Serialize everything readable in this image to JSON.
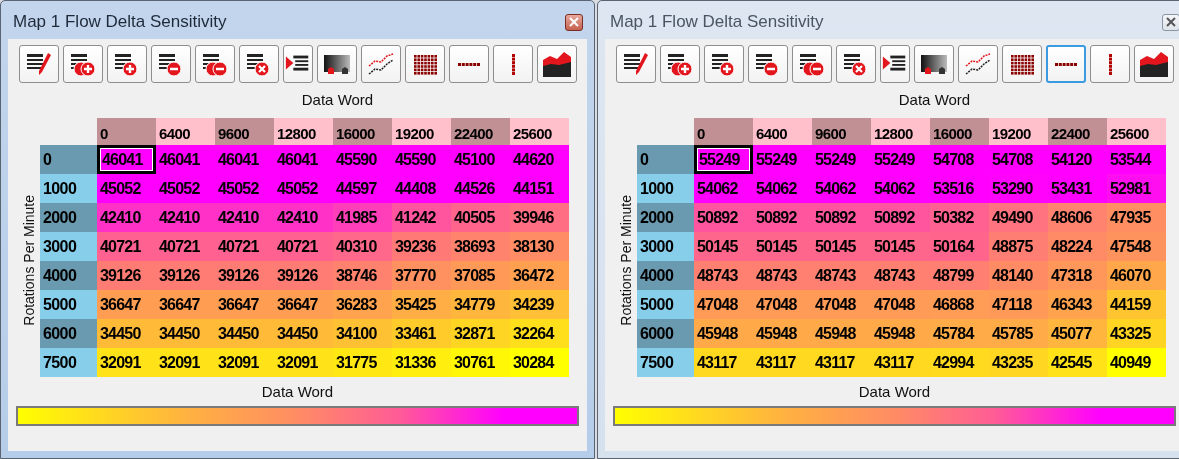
{
  "windows": [
    {
      "title": "Map 1 Flow Delta Sensitivity",
      "active": true,
      "toolbar": [
        {
          "kind": "edit",
          "selected": false
        },
        {
          "kind": "insert-columns",
          "selected": false
        },
        {
          "kind": "insert-row",
          "selected": false
        },
        {
          "kind": "delete-row",
          "selected": false
        },
        {
          "kind": "delete-columns",
          "selected": false
        },
        {
          "kind": "clear",
          "selected": false
        },
        {
          "kind": "export",
          "selected": false
        },
        {
          "kind": "gradient",
          "selected": false
        },
        {
          "kind": "line-chart",
          "selected": false
        },
        {
          "kind": "grid",
          "selected": false
        },
        {
          "kind": "row-line",
          "selected": false
        },
        {
          "kind": "column-line",
          "selected": false
        },
        {
          "kind": "area-chart",
          "selected": false
        }
      ],
      "top_axis_label": "Data Word",
      "side_axis_label": "Rotations Per Minute",
      "bottom_axis_label": "Data Word",
      "columns": [
        "0",
        "6400",
        "9600",
        "12800",
        "16000",
        "19200",
        "22400",
        "25600"
      ],
      "rows": [
        {
          "label": "0",
          "cells": [
            {
              "value": "46041",
              "selected": true
            },
            {
              "value": "46041",
              "selected": false
            },
            {
              "value": "46041",
              "selected": false
            },
            {
              "value": "46041",
              "selected": false
            },
            {
              "value": "45590",
              "selected": false
            },
            {
              "value": "45590",
              "selected": false
            },
            {
              "value": "45100",
              "selected": false
            },
            {
              "value": "44620",
              "selected": false
            }
          ]
        },
        {
          "label": "1000",
          "cells": [
            {
              "value": "45052",
              "selected": false
            },
            {
              "value": "45052",
              "selected": false
            },
            {
              "value": "45052",
              "selected": false
            },
            {
              "value": "45052",
              "selected": false
            },
            {
              "value": "44597",
              "selected": false
            },
            {
              "value": "44408",
              "selected": false
            },
            {
              "value": "44526",
              "selected": false
            },
            {
              "value": "44151",
              "selected": false
            }
          ]
        },
        {
          "label": "2000",
          "cells": [
            {
              "value": "42410",
              "selected": false
            },
            {
              "value": "42410",
              "selected": false
            },
            {
              "value": "42410",
              "selected": false
            },
            {
              "value": "42410",
              "selected": false
            },
            {
              "value": "41985",
              "selected": false
            },
            {
              "value": "41242",
              "selected": false
            },
            {
              "value": "40505",
              "selected": false
            },
            {
              "value": "39946",
              "selected": false
            }
          ]
        },
        {
          "label": "3000",
          "cells": [
            {
              "value": "40721",
              "selected": false
            },
            {
              "value": "40721",
              "selected": false
            },
            {
              "value": "40721",
              "selected": false
            },
            {
              "value": "40721",
              "selected": false
            },
            {
              "value": "40310",
              "selected": false
            },
            {
              "value": "39236",
              "selected": false
            },
            {
              "value": "38693",
              "selected": false
            },
            {
              "value": "38130",
              "selected": false
            }
          ]
        },
        {
          "label": "4000",
          "cells": [
            {
              "value": "39126",
              "selected": false
            },
            {
              "value": "39126",
              "selected": false
            },
            {
              "value": "39126",
              "selected": false
            },
            {
              "value": "39126",
              "selected": false
            },
            {
              "value": "38746",
              "selected": false
            },
            {
              "value": "37770",
              "selected": false
            },
            {
              "value": "37085",
              "selected": false
            },
            {
              "value": "36472",
              "selected": false
            }
          ]
        },
        {
          "label": "5000",
          "cells": [
            {
              "value": "36647",
              "selected": false
            },
            {
              "value": "36647",
              "selected": false
            },
            {
              "value": "36647",
              "selected": false
            },
            {
              "value": "36647",
              "selected": false
            },
            {
              "value": "36283",
              "selected": false
            },
            {
              "value": "35425",
              "selected": false
            },
            {
              "value": "34779",
              "selected": false
            },
            {
              "value": "34239",
              "selected": false
            }
          ]
        },
        {
          "label": "6000",
          "cells": [
            {
              "value": "34450",
              "selected": false
            },
            {
              "value": "34450",
              "selected": false
            },
            {
              "value": "34450",
              "selected": false
            },
            {
              "value": "34450",
              "selected": false
            },
            {
              "value": "34100",
              "selected": false
            },
            {
              "value": "33461",
              "selected": false
            },
            {
              "value": "32871",
              "selected": false
            },
            {
              "value": "32264",
              "selected": false
            }
          ]
        },
        {
          "label": "7500",
          "cells": [
            {
              "value": "32091",
              "selected": false
            },
            {
              "value": "32091",
              "selected": false
            },
            {
              "value": "32091",
              "selected": false
            },
            {
              "value": "32091",
              "selected": false
            },
            {
              "value": "31775",
              "selected": false
            },
            {
              "value": "31336",
              "selected": false
            },
            {
              "value": "30761",
              "selected": false
            },
            {
              "value": "30284",
              "selected": false
            }
          ]
        }
      ]
    },
    {
      "title": "Map 1 Flow Delta Sensitivity",
      "active": false,
      "toolbar": [
        {
          "kind": "edit",
          "selected": false
        },
        {
          "kind": "insert-columns",
          "selected": false
        },
        {
          "kind": "insert-row",
          "selected": false
        },
        {
          "kind": "delete-row",
          "selected": false
        },
        {
          "kind": "delete-columns",
          "selected": false
        },
        {
          "kind": "clear",
          "selected": false
        },
        {
          "kind": "export",
          "selected": false
        },
        {
          "kind": "gradient",
          "selected": false
        },
        {
          "kind": "line-chart",
          "selected": false
        },
        {
          "kind": "grid",
          "selected": false
        },
        {
          "kind": "row-line",
          "selected": true
        },
        {
          "kind": "column-line",
          "selected": false
        },
        {
          "kind": "area-chart",
          "selected": false
        }
      ],
      "top_axis_label": "Data Word",
      "side_axis_label": "Rotations Per Minute",
      "bottom_axis_label": "Data Word",
      "columns": [
        "0",
        "6400",
        "9600",
        "12800",
        "16000",
        "19200",
        "22400",
        "25600"
      ],
      "rows": [
        {
          "label": "0",
          "cells": [
            {
              "value": "55249",
              "selected": true
            },
            {
              "value": "55249",
              "selected": false
            },
            {
              "value": "55249",
              "selected": false
            },
            {
              "value": "55249",
              "selected": false
            },
            {
              "value": "54708",
              "selected": false
            },
            {
              "value": "54708",
              "selected": false
            },
            {
              "value": "54120",
              "selected": false
            },
            {
              "value": "53544",
              "selected": false
            }
          ]
        },
        {
          "label": "1000",
          "cells": [
            {
              "value": "54062",
              "selected": false
            },
            {
              "value": "54062",
              "selected": false
            },
            {
              "value": "54062",
              "selected": false
            },
            {
              "value": "54062",
              "selected": false
            },
            {
              "value": "53516",
              "selected": false
            },
            {
              "value": "53290",
              "selected": false
            },
            {
              "value": "53431",
              "selected": false
            },
            {
              "value": "52981",
              "selected": false
            }
          ]
        },
        {
          "label": "2000",
          "cells": [
            {
              "value": "50892",
              "selected": false
            },
            {
              "value": "50892",
              "selected": false
            },
            {
              "value": "50892",
              "selected": false
            },
            {
              "value": "50892",
              "selected": false
            },
            {
              "value": "50382",
              "selected": false
            },
            {
              "value": "49490",
              "selected": false
            },
            {
              "value": "48606",
              "selected": false
            },
            {
              "value": "47935",
              "selected": false
            }
          ]
        },
        {
          "label": "3000",
          "cells": [
            {
              "value": "50145",
              "selected": false
            },
            {
              "value": "50145",
              "selected": false
            },
            {
              "value": "50145",
              "selected": false
            },
            {
              "value": "50145",
              "selected": false
            },
            {
              "value": "50164",
              "selected": false
            },
            {
              "value": "48875",
              "selected": false
            },
            {
              "value": "48224",
              "selected": false
            },
            {
              "value": "47548",
              "selected": false
            }
          ]
        },
        {
          "label": "4000",
          "cells": [
            {
              "value": "48743",
              "selected": false
            },
            {
              "value": "48743",
              "selected": false
            },
            {
              "value": "48743",
              "selected": false
            },
            {
              "value": "48743",
              "selected": false
            },
            {
              "value": "48799",
              "selected": false
            },
            {
              "value": "48140",
              "selected": false
            },
            {
              "value": "47318",
              "selected": false
            },
            {
              "value": "46070",
              "selected": false
            }
          ]
        },
        {
          "label": "5000",
          "cells": [
            {
              "value": "47048",
              "selected": false
            },
            {
              "value": "47048",
              "selected": false
            },
            {
              "value": "47048",
              "selected": false
            },
            {
              "value": "47048",
              "selected": false
            },
            {
              "value": "46868",
              "selected": false
            },
            {
              "value": "47118",
              "selected": false
            },
            {
              "value": "46343",
              "selected": false
            },
            {
              "value": "44159",
              "selected": false
            }
          ]
        },
        {
          "label": "6000",
          "cells": [
            {
              "value": "45948",
              "selected": false
            },
            {
              "value": "45948",
              "selected": false
            },
            {
              "value": "45948",
              "selected": false
            },
            {
              "value": "45948",
              "selected": false
            },
            {
              "value": "45784",
              "selected": false
            },
            {
              "value": "45785",
              "selected": false
            },
            {
              "value": "45077",
              "selected": false
            },
            {
              "value": "43325",
              "selected": false
            }
          ]
        },
        {
          "label": "7500",
          "cells": [
            {
              "value": "43117",
              "selected": false
            },
            {
              "value": "43117",
              "selected": false
            },
            {
              "value": "43117",
              "selected": false
            },
            {
              "value": "43117",
              "selected": false
            },
            {
              "value": "42994",
              "selected": false
            },
            {
              "value": "43235",
              "selected": false
            },
            {
              "value": "42545",
              "selected": false
            },
            {
              "value": "40949",
              "selected": false
            }
          ]
        }
      ]
    }
  ]
}
